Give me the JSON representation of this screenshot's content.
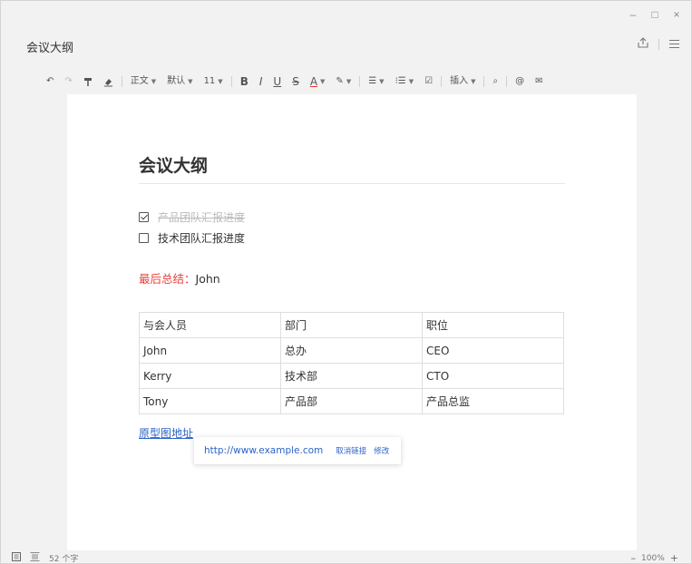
{
  "window_controls": {
    "minimize": "–",
    "maximize": "□",
    "close": "×"
  },
  "header": {
    "title": "会议大纲",
    "share_icon": "share-icon",
    "menu_icon": "menu-icon"
  },
  "toolbar": {
    "undo": "↶",
    "redo": "↷",
    "format_painter": "⚲",
    "clear_format": "⌫",
    "paragraph_style": "正文",
    "font_family": "默认",
    "font_size": "11",
    "bold": "B",
    "italic": "I",
    "underline": "U",
    "strikethrough": "S",
    "font_color": "A",
    "highlight": "✎",
    "align": "☰",
    "list": "⁝☰",
    "checklist": "☑",
    "insert": "插入",
    "find": "⌕",
    "mention": "@",
    "comment": "✉"
  },
  "document": {
    "heading": "会议大纲",
    "todos": [
      {
        "text": "产品团队汇报进度",
        "checked": true
      },
      {
        "text": "技术团队汇报进度",
        "checked": false
      }
    ],
    "summary_label": "最后总结：",
    "summary_value": "John",
    "table": {
      "rows": [
        [
          "与会人员",
          "部门",
          "职位"
        ],
        [
          "John",
          "总办",
          "CEO"
        ],
        [
          "Kerry",
          "技术部",
          "CTO"
        ],
        [
          "Tony",
          "产品部",
          "产品总监"
        ]
      ]
    },
    "link_text": "原型图地址"
  },
  "link_popup": {
    "url": "http://www.example.com",
    "unlink": "取消链接",
    "edit": "修改"
  },
  "statusbar": {
    "word_count": "52 个字",
    "zoom_out": "–",
    "zoom": "100%",
    "zoom_in": "+"
  },
  "colors": {
    "summary_label": "#e8413b",
    "link": "#2b63c8"
  }
}
